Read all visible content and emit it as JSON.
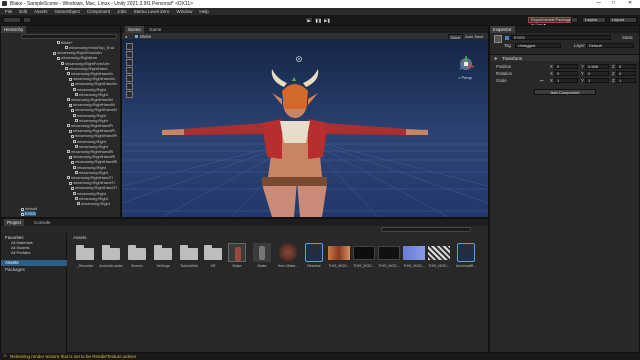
{
  "window": {
    "title": "Blake - SampleScene - Windows, Mac, Linux - Unity 2021.3.9f1 Personal* <DX11>",
    "controls": [
      "—",
      "□",
      "✕"
    ]
  },
  "menu": [
    "File",
    "Edit",
    "Assets",
    "GameObject",
    "Component",
    "Jobs",
    "Stereo Level Zero",
    "Window",
    "Help"
  ],
  "toolbar": {
    "experimental": "Experimental Packages In Use ▾",
    "layers": "Layers",
    "layout": "Layout"
  },
  "hierarchy": {
    "tab": "Hierarchy",
    "root": "Blake*",
    "items": [
      "mixamorig:HeadTop_End",
      "mixamorig:RightShoulder",
      "mixamorig:RightArm",
      "mixamorig:RightForeArm",
      "mixamorig:RightHand",
      "mixamorig:RightHandIn",
      "mixamorig:RightHandIn",
      "mixamorig:RightHandIn",
      "mixamorig:Right",
      "mixamorig:Right",
      "mixamorig:RightHandM",
      "mixamorig:RightHandM",
      "mixamorig:RightHandM",
      "mixamorig:Right",
      "mixamorig:Right",
      "mixamorig:RightHandPi",
      "mixamorig:RightHandPi",
      "mixamorig:RightHandPi",
      "mixamorig:Right",
      "mixamorig:Right",
      "mixamorig:RightHandRi",
      "mixamorig:RightHandRi",
      "mixamorig:RightHandRi",
      "mixamorig:Right",
      "mixamorig:Right",
      "mixamorig:RightHandTl",
      "mixamorig:RightHandTl",
      "mixamorig:RightHandTl",
      "mixamorig:Right",
      "mixamorig:Right",
      "mixamorig:Right",
      "default",
      "EYES"
    ]
  },
  "scene": {
    "tabs": [
      "Scene",
      "Game"
    ],
    "breadcrumb": "Blake",
    "save": "Save",
    "persp": "< Persp"
  },
  "project": {
    "tabs": [
      "Project",
      "Console"
    ],
    "favorites_title": "Favorites",
    "favorites": [
      "All Materials",
      "All Models",
      "All Prefabs"
    ],
    "assets_title": "Assets",
    "packages_title": "Packages",
    "breadcrumb": "Assets",
    "items": [
      "_Recorder",
      "AndroidLoader",
      "Scenes",
      "Settings",
      "TutorialInfo",
      "XR",
      "Blake",
      "Blake",
      "Hero Mater...",
      "Readme",
      "THIS_MOD...",
      "THIS_MOD...",
      "THIS_MOD...",
      "THIS_MOD...",
      "THIS_MOD...",
      "UniversalR..."
    ]
  },
  "inspector": {
    "tab": "Inspector",
    "object_name": "EYES",
    "static": "Static",
    "tag_label": "Tag",
    "tag_value": "Untagged",
    "layer_label": "Layer",
    "layer_value": "Default",
    "transform_title": "Transform",
    "position_label": "Position",
    "rotation_label": "Rotation",
    "scale_label": "Scale",
    "position": {
      "x": "0",
      "y": "0.568",
      "z": "0"
    },
    "rotation": {
      "x": "0",
      "y": "0",
      "z": "0"
    },
    "scale": {
      "x": "1",
      "y": "1",
      "z": "1"
    },
    "add_component": "Add Component"
  },
  "status": "Releasing render texture that is set to be RenderTexture.active!"
}
